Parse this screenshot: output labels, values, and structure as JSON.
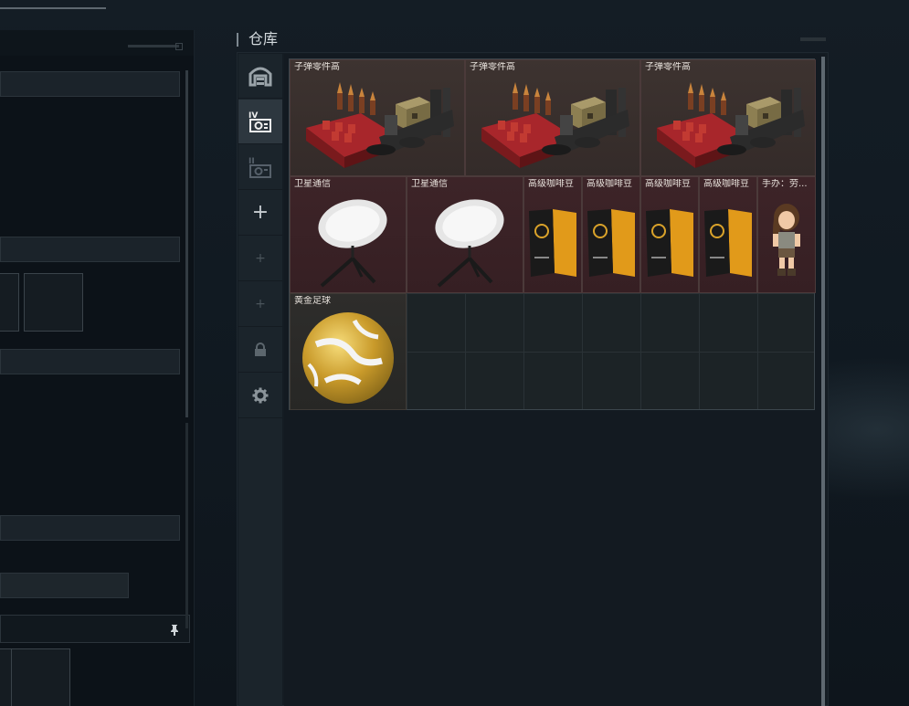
{
  "warehouse": {
    "title": "仓库",
    "sidebar": [
      {
        "icon": "warehouse-icon",
        "active": false
      },
      {
        "icon": "safe-box-iv-icon",
        "active": true
      },
      {
        "icon": "safe-box-ii-icon",
        "active": false
      },
      {
        "icon": "plus-icon",
        "active": false
      },
      {
        "icon": "plus-icon",
        "active": false
      },
      {
        "icon": "plus-icon",
        "active": false
      },
      {
        "icon": "lock-icon",
        "active": false
      },
      {
        "icon": "gear-icon",
        "active": false
      }
    ],
    "items": [
      {
        "label": "子弹零件高",
        "icon": "ammo-parts-crate-icon"
      },
      {
        "label": "子弹零件高",
        "icon": "ammo-parts-crate-icon"
      },
      {
        "label": "子弹零件高",
        "icon": "ammo-parts-crate-icon"
      },
      {
        "label": "卫星通信",
        "icon": "satellite-dish-icon"
      },
      {
        "label": "卫星通信",
        "icon": "satellite-dish-icon"
      },
      {
        "label": "高级咖啡豆",
        "icon": "coffee-bag-icon"
      },
      {
        "label": "高级咖啡豆",
        "icon": "coffee-bag-icon"
      },
      {
        "label": "高级咖啡豆",
        "icon": "coffee-bag-icon"
      },
      {
        "label": "高级咖啡豆",
        "icon": "coffee-bag-icon"
      },
      {
        "label": "手办：劳...",
        "icon": "figurine-icon"
      },
      {
        "label": "黄金足球",
        "icon": "golden-football-icon"
      }
    ]
  },
  "left_panel": {
    "pin_icon": "pin-icon"
  }
}
